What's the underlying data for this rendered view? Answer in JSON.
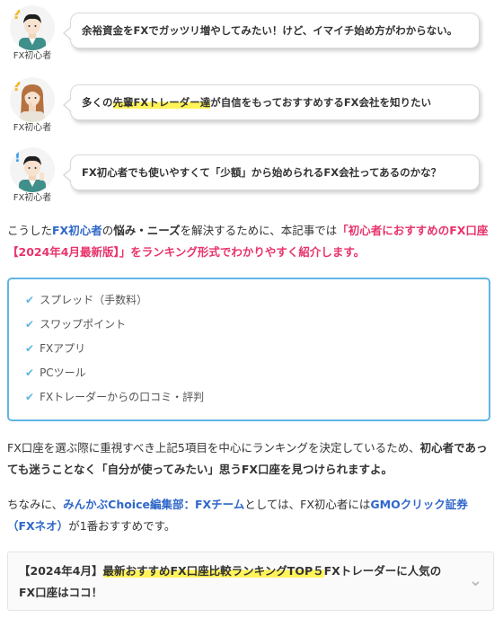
{
  "dialogs": [
    {
      "avatar_name": "FX初心者",
      "parts": [
        {
          "text": "余裕資金をFXでガッツリ増やしてみたい！けど、イマイチ始め方がわからない。",
          "hl": false
        }
      ]
    },
    {
      "avatar_name": "FX初心者",
      "parts": [
        {
          "text": "多くの",
          "hl": false
        },
        {
          "text": "先輩FXトレーダー達",
          "hl": true
        },
        {
          "text": "が自信をもっておすすめするFX会社を知りたい",
          "hl": false
        }
      ]
    },
    {
      "avatar_name": "FX初心者",
      "parts": [
        {
          "text": "FX初心者でも使いやすくて「少額」から始められるFX会社ってあるのかな？",
          "hl": false
        }
      ]
    }
  ],
  "intro": {
    "p1": "こうした",
    "p2": "FX初心者",
    "p3": "の",
    "p4": "悩み・ニーズ",
    "p5": "を解決するために、本記事では",
    "p6": "「初心者におすすめのFX口座【2024年4月最新版】」をランキング形式でわかりやすく紹介します。"
  },
  "checklist": [
    "スプレッド（手数料）",
    "スワップポイント",
    "FXアプリ",
    "PCツール",
    "FXトレーダーからの口コミ・評判"
  ],
  "para2": {
    "p1": "FX口座を選ぶ際に重視すべき上記5項目を中心にランキングを決定しているため、",
    "p2": "初心者であっても迷うことなく「自分が使ってみたい」思うFX口座を見つけられますよ。"
  },
  "para3": {
    "p1": "ちなみに、",
    "p2": "みんかぶChoice編集部：FXチーム",
    "p3": "としては、FX初心者には",
    "p4": "GMOクリック証券（FXネオ）",
    "p5": "が1番おすすめです。"
  },
  "toc": {
    "prefix": "【2024年4月】",
    "highlight": "最新おすすめFX口座比較ランキングTOP５",
    "rest": "FXトレーダーに人気のFX口座はココ！"
  },
  "icons": {
    "check": "check-icon",
    "chevron": "chevron-down-icon",
    "question": "question-mark-icon",
    "exclaim": "exclamation-icon"
  },
  "colors": {
    "accent_blue": "#2f67c9",
    "accent_pink": "#e8336b",
    "highlight": "#fff35a",
    "list_border": "#5fb6e4"
  }
}
